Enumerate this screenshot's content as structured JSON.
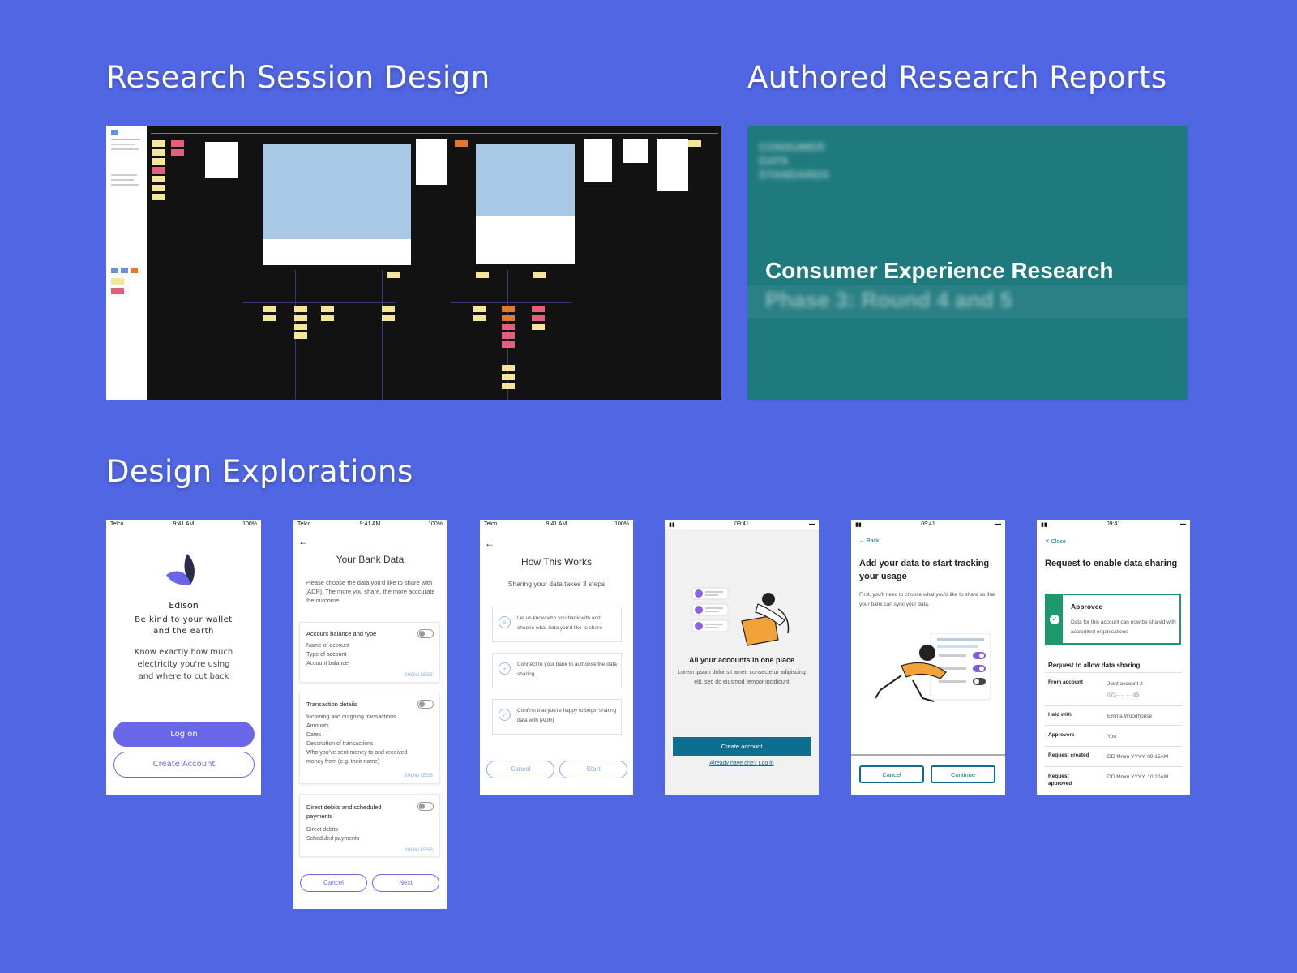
{
  "headings": {
    "research": "Research Session Design",
    "reports": "Authored Research Reports",
    "explorations": "Design Explorations"
  },
  "report": {
    "logo_text": "CONSUMER DATA STANDARDS",
    "title": "Consumer Experience Research",
    "subtitle": "Phase 3: Round 4 and 5"
  },
  "phone1": {
    "status_left": "Telco",
    "status_time": "9:41 AM",
    "status_right": "100%",
    "brand": "Edison",
    "tagline": "Be kind to your wallet and the earth",
    "description": "Know exactly how much electricity you're using and where to cut back",
    "login_label": "Log on",
    "create_label": "Create Account"
  },
  "phone2": {
    "status_left": "Telco",
    "status_time": "9:41 AM",
    "status_right": "100%",
    "back": "←",
    "title": "Your Bank Data",
    "intro": "Please choose the data you'd like to share with [ADR]. The more you share, the more acccurate the outcome",
    "sections": [
      {
        "title": "Account balance and type",
        "items": [
          "Name of account",
          "Type of account",
          "Account balance"
        ],
        "link": "SHOW LESS"
      },
      {
        "title": "Transaction details",
        "items": [
          "Incoming and outgoing transactions",
          "Amounts",
          "Dates",
          "Description of transactions",
          "Who you've sent money to and received money from (e.g. their name)"
        ],
        "link": "SHOW LESS"
      },
      {
        "title": "Direct debits and scheduled payments",
        "items": [
          "Direct debits",
          "Scheduled payments"
        ],
        "link": "SHOW LESS"
      }
    ],
    "cancel_label": "Cancel",
    "next_label": "Next"
  },
  "phone3": {
    "status_left": "Telco",
    "status_time": "9:41 AM",
    "status_right": "100%",
    "back": "←",
    "title": "How This Works",
    "subtitle": "Sharing your data takes 3 steps",
    "steps": [
      "Let us know who you bank with and choose what data you'd like to share",
      "Connect to your bank to authorise the data sharing",
      "Confirm that you're happy to begin sharing data with [ADR]"
    ],
    "cancel_label": "Cancel",
    "start_label": "Start"
  },
  "phone4": {
    "status_time": "09:41",
    "heading": "All your accounts in one place",
    "body": "Lorem ipsum dolor sit amet, consectetur adipiscing elit, sed do eiusmod tempor incididunt",
    "create_label": "Create account",
    "login_link": "Already have one? Log in"
  },
  "phone5": {
    "status_time": "09:41",
    "back": "← Back",
    "title": "Add your data to start tracking your usage",
    "body": "First, you'll need to choose what you'd like to share so that your bank can sync your data.",
    "cancel_label": "Cancel",
    "continue_label": "Continue"
  },
  "phone6": {
    "status_time": "09:41",
    "close": "✕ Close",
    "title": "Request to enable data sharing",
    "approved_title": "Approved",
    "approved_body": "Data for this account can now be shared with accredited organisations",
    "section_title": "Request to allow data sharing",
    "rows": [
      {
        "label": "From account",
        "value": "Joint account 2",
        "value2": "072-···· ····85"
      },
      {
        "label": "Held with",
        "value": "Emma Woodhouse"
      },
      {
        "label": "Approvers",
        "value": "You"
      },
      {
        "label": "Request created",
        "value": "DD Mmm YYYY, 09:15AM"
      },
      {
        "label": "Request approved",
        "value": "DD Mmm YYYY, 10:20AM"
      }
    ]
  },
  "colors": {
    "background": "#5066e2",
    "accent_purple": "#6a66e8",
    "report_teal": "#1f7a7e",
    "cta_teal": "#0d6e8f",
    "approved_green": "#1a9a6a"
  }
}
